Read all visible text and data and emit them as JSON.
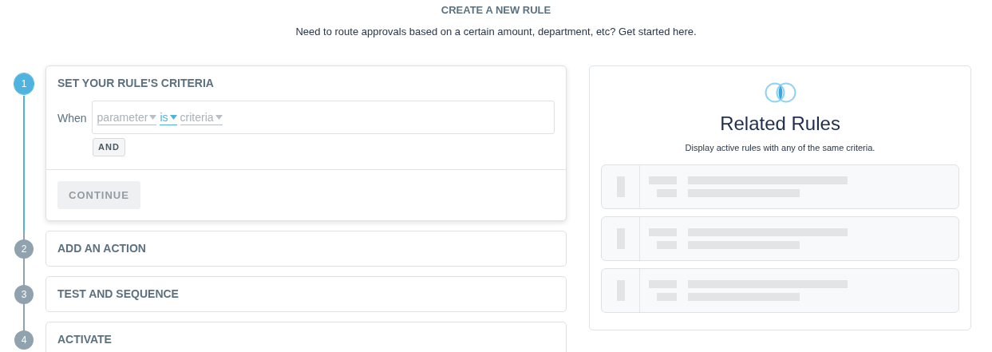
{
  "header": {
    "title": "CREATE A NEW RULE",
    "subtitle": "Need to route approvals based on a certain amount, department, etc? Get started here."
  },
  "steps": [
    {
      "number": "1",
      "title": "SET YOUR RULE'S CRITERIA",
      "selected": true,
      "condition": {
        "label": "When",
        "tokens": [
          {
            "text": "parameter",
            "filled": false
          },
          {
            "text": "is",
            "filled": true
          },
          {
            "text": "criteria",
            "filled": false
          }
        ]
      },
      "and_button": "AND",
      "continue_button": {
        "label": "CONTINUE",
        "disabled": true
      }
    },
    {
      "number": "2",
      "title": "ADD AN ACTION",
      "selected": false
    },
    {
      "number": "3",
      "title": "TEST AND SEQUENCE",
      "selected": false
    },
    {
      "number": "4",
      "title": "ACTIVATE",
      "selected": false
    }
  ],
  "related": {
    "title": "Related Rules",
    "subtitle": "Display active rules with any of the same criteria.",
    "rows": [
      {
        "kind": "skeleton"
      },
      {
        "kind": "skeleton"
      },
      {
        "kind": "skeleton"
      }
    ]
  }
}
